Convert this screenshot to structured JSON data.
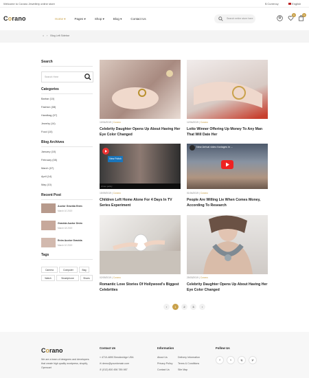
{
  "topbar": {
    "welcome": "Welcome to Corano Jewellery online store",
    "currency": "$ Currency",
    "language": "English"
  },
  "header": {
    "logo_prefix": "C",
    "logo_o": "o",
    "logo_suffix": "rano",
    "nav": [
      {
        "label": "Home",
        "active": true
      },
      {
        "label": "Pages",
        "active": false
      },
      {
        "label": "Shop",
        "active": false
      },
      {
        "label": "Blog",
        "active": false
      },
      {
        "label": "Contact Us",
        "active": false
      }
    ],
    "search_placeholder": "Search entire store here",
    "wishlist_count": "0",
    "cart_count": "0"
  },
  "breadcrumb": {
    "home": "⌂",
    "sep": "›",
    "current": "Blog Left Sidebar"
  },
  "sidebar": {
    "search_title": "Search",
    "search_placeholder": "Search Here",
    "categories_title": "Categories",
    "categories": [
      "Barbar (10)",
      "Fashion (08)",
      "Handbag (07)",
      "Jewelry (14)",
      "Food (10)"
    ],
    "archives_title": "Blog Archives",
    "archives": [
      "January (10)",
      "February (08)",
      "March (07)",
      "April (14)",
      "May (10)"
    ],
    "recent_title": "Recent Post",
    "recent": [
      {
        "title": "Auctor Gravida Enim",
        "date": "March 10 2019"
      },
      {
        "title": "Gravida Auctor Dnim",
        "date": "March 18 2019"
      },
      {
        "title": "Enim Auctor Gravida",
        "date": "March 10 2019"
      }
    ],
    "tags_title": "Tags",
    "tags": [
      "Camera",
      "Computer",
      "Bag",
      "Watch",
      "Smartphone",
      "Shoes"
    ]
  },
  "posts": [
    {
      "date": "10/04/2019",
      "author": "Corano",
      "title": "Celebrity Daughter Opens Up About Having Her Eye Color Changed",
      "bg": "#cbb9b2"
    },
    {
      "date": "12/04/2019",
      "author": "Corano",
      "title": "Lotto Winner Offering Up Money To Any Man That Will Date Her",
      "bg": "#d8d0cb"
    },
    {
      "date": "15/09/2019",
      "author": "Corano",
      "title": "Children Left Home Alone For 4 Days In TV Series Experiment",
      "bg": "#6d7d8f"
    },
    {
      "date": "01/04/2019",
      "author": "Corano",
      "title": "People Are Willing Lie When Comes Money, According To Research",
      "bg": "#7f8a99"
    },
    {
      "date": "02/09/2019",
      "author": "Corano",
      "title": "Romantic Love Stories Of Hollywood's Biggest Celebrities",
      "bg": "#e3e1df"
    },
    {
      "date": "25/03/2019",
      "author": "Corano",
      "title": "Celebrity Daughter Opens Up About Having Her Eye Color Changed",
      "bg": "#c6c4c2"
    }
  ],
  "video1": {
    "title": "New Polish",
    "caption": "vimeo policy"
  },
  "video2": {
    "title": "New Arrival video footages in ..."
  },
  "pagination": [
    "‹",
    "1",
    "2",
    "3",
    "›"
  ],
  "footer": {
    "logo_prefix": "C",
    "logo_o": "o",
    "logo_suffix": "rano",
    "about": "We are a team of designers and developers that create high quality wordpress, shopify, Opencart",
    "contact_title": "Contact Us",
    "contact": [
      "4710-4890 Breckinridge USA",
      "demo@yourdomain.com",
      "(012) 800 456 789-987"
    ],
    "info_title": "Information",
    "info_col1": [
      "About Us",
      "Privacy Policy",
      "Contact Us"
    ],
    "info_col2": [
      "Delivery Information",
      "Terms & Conditions",
      "Site Map"
    ],
    "follow_title": "Follow Us",
    "social": [
      "f",
      "t",
      "ig",
      "yt"
    ]
  }
}
